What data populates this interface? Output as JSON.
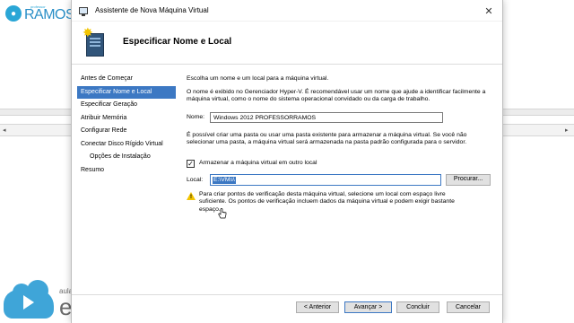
{
  "background": {
    "logo_small": "professor",
    "logo_text": "RAMOS",
    "brand_aula": "aula",
    "brand_ead": "ead"
  },
  "dialog": {
    "title": "Assistente de Nova Máquina Virtual",
    "header_title": "Especificar Nome e Local"
  },
  "nav": {
    "items": [
      {
        "label": "Antes de Começar"
      },
      {
        "label": "Especificar Nome e Local"
      },
      {
        "label": "Especificar Geração"
      },
      {
        "label": "Atribuir Memória"
      },
      {
        "label": "Configurar Rede"
      },
      {
        "label": "Conectar Disco Rígido Virtual"
      },
      {
        "label": "Opções de Instalação"
      },
      {
        "label": "Resumo"
      }
    ]
  },
  "content": {
    "intro": "Escolha um nome e um local para a máquina virtual.",
    "description": "O nome é exibido no Gerenciador Hyper-V. É recomendável usar um nome que ajude a identificar facilmente a máquina virtual, como o nome do sistema operacional convidado ou da carga de trabalho.",
    "name_label": "Nome:",
    "name_value": "Windows 2012 PROFESSORRAMOS",
    "folder_info": "É possível criar uma pasta ou usar uma pasta existente para armazenar a máquina virtual. Se você não selecionar uma pasta, a máquina virtual será armazenada na pasta padrão configurada para o servidor.",
    "store_checkbox_label": "Armazenar a máquina virtual em outro local",
    "store_checked": true,
    "location_label": "Local:",
    "location_value": "E:\\VMs\\",
    "browse_label": "Procurar...",
    "warning": "Para criar pontos de verificação desta máquina virtual, selecione um local com espaço livre suficiente. Os pontos de verificação incluem dados da máquina virtual e podem exigir bastante espaço."
  },
  "footer": {
    "back_label": "< Anterior",
    "next_label": "Avançar >",
    "finish_label": "Concluir",
    "cancel_label": "Cancelar"
  }
}
